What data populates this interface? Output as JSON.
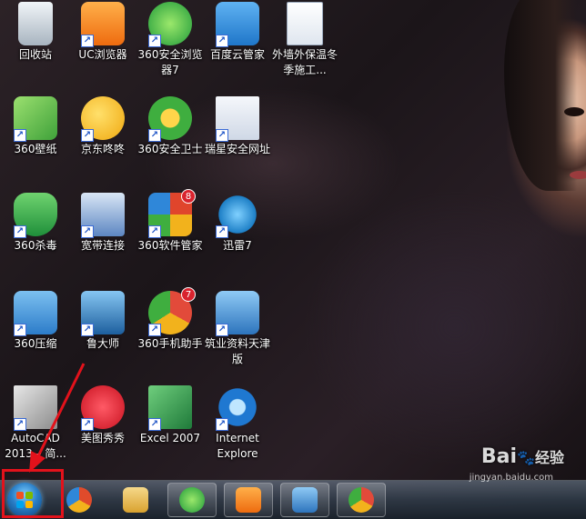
{
  "desktop": {
    "icons": [
      {
        "label": "回收站",
        "icon": "recycle-bin-icon",
        "color": "#cfd6de",
        "shortcut": false
      },
      {
        "label": "UC浏览器",
        "icon": "uc-browser-icon",
        "color": "#f28a1c",
        "shortcut": true
      },
      {
        "label": "360安全浏览器7",
        "icon": "360-browser-icon",
        "color": "#38b54a",
        "shortcut": true
      },
      {
        "label": "百度云管家",
        "icon": "baidu-cloud-icon",
        "color": "#2d8fe0",
        "shortcut": true
      },
      {
        "label": "外墙外保温冬季施工...",
        "icon": "word-document-icon",
        "color": "#2a5699",
        "shortcut": false
      },
      {
        "label": "360壁纸",
        "icon": "360-wallpaper-icon",
        "color": "#6cc04a",
        "shortcut": true
      },
      {
        "label": "京东咚咚",
        "icon": "jd-dongdong-icon",
        "color": "#f2b21c",
        "shortcut": true
      },
      {
        "label": "360安全卫士",
        "icon": "360-security-icon",
        "color": "#3fae3f",
        "shortcut": true
      },
      {
        "label": "瑞星安全网址",
        "icon": "rising-browser-icon",
        "color": "#2f87d9",
        "shortcut": true
      },
      {
        "label": "360杀毒",
        "icon": "360-antivirus-icon",
        "color": "#3db04f",
        "shortcut": true
      },
      {
        "label": "宽带连接",
        "icon": "broadband-connection-icon",
        "color": "#4f7fbf",
        "shortcut": true
      },
      {
        "label": "360软件管家",
        "icon": "360-software-manager-icon",
        "color": "#e0452c",
        "shortcut": true,
        "badge": "8"
      },
      {
        "label": "迅雷7",
        "icon": "thunder-icon",
        "color": "#2a9ad8",
        "shortcut": true
      },
      {
        "label": "360压缩",
        "icon": "360-compress-icon",
        "color": "#3b93d8",
        "shortcut": true
      },
      {
        "label": "鲁大师",
        "icon": "ludashi-icon",
        "color": "#2a6fb5",
        "shortcut": true
      },
      {
        "label": "360手机助手",
        "icon": "360-phone-assistant-icon",
        "color": "#e24a3a",
        "shortcut": true,
        "badge": "7"
      },
      {
        "label": "筑业资料天津版",
        "icon": "zhuye-house-icon",
        "color": "#3d8ad1",
        "shortcut": true
      },
      {
        "label": "AutoCAD 2013 – 简...",
        "icon": "autocad-icon",
        "color": "#b61d24",
        "shortcut": true
      },
      {
        "label": "美图秀秀",
        "icon": "meitu-icon",
        "color": "#d8202e",
        "shortcut": true
      },
      {
        "label": "Excel 2007",
        "icon": "excel-icon",
        "color": "#1f7a3a",
        "shortcut": true
      },
      {
        "label": "Internet Explore",
        "icon": "internet-explorer-icon",
        "color": "#1f78d1",
        "shortcut": true
      }
    ]
  },
  "taskbar": {
    "start": {
      "icon": "windows-start-icon"
    },
    "pinned": [
      {
        "icon": "chrome-like-icon",
        "color": "#e04b2b"
      },
      {
        "icon": "file-explorer-icon",
        "color": "#e8b84b"
      },
      {
        "icon": "360-browser-taskbar-icon",
        "color": "#38b54a"
      },
      {
        "icon": "uc-browser-taskbar-icon",
        "color": "#f28a1c"
      },
      {
        "icon": "zhuye-taskbar-icon",
        "color": "#3d8ad1"
      },
      {
        "icon": "360-phone-taskbar-icon",
        "color": "#e24a3a"
      }
    ]
  },
  "watermark": {
    "brand": "Bai",
    "brand2": "经验",
    "url": "jingyan.baidu.com"
  }
}
